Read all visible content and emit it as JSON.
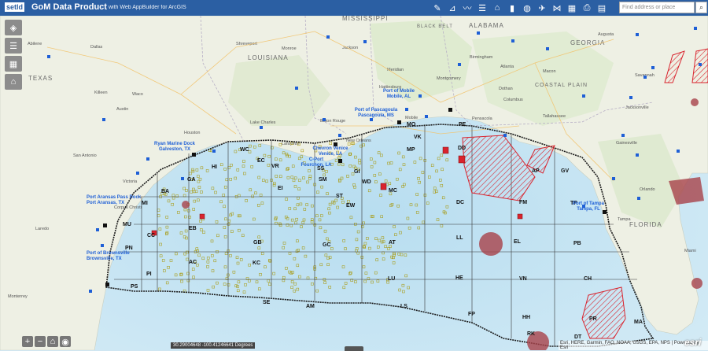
{
  "header": {
    "logo": "setld",
    "title": "GoM Data Product",
    "subtitle": "with Web AppBuilder for ArcGIS",
    "search_placeholder": "Find address or place",
    "tools": [
      "pen-icon",
      "ruler-icon",
      "chart-icon",
      "layers-list-icon",
      "graduation-icon",
      "bar-chart-icon",
      "globe-icon",
      "bird-icon",
      "fish-icon",
      "grid-icon",
      "print-icon",
      "table-icon"
    ]
  },
  "side_widgets": [
    "layers-icon",
    "legend-icon",
    "basemap-icon",
    "bookmark-icon"
  ],
  "states": [
    {
      "name": "MISSISSIPPI"
    },
    {
      "name": "ALABAMA"
    },
    {
      "name": "GEORGIA"
    },
    {
      "name": "LOUISIANA"
    },
    {
      "name": "TEXAS"
    },
    {
      "name": "FLORIDA"
    },
    {
      "name": "BLACK BELT"
    },
    {
      "name": "COASTAL PLAIN"
    }
  ],
  "cities": [
    {
      "name": "Abilene"
    },
    {
      "name": "Dallas"
    },
    {
      "name": "Shreveport"
    },
    {
      "name": "Monroe"
    },
    {
      "name": "Jackson"
    },
    {
      "name": "Meridian"
    },
    {
      "name": "Birmingham"
    },
    {
      "name": "Atlanta"
    },
    {
      "name": "Montgomery"
    },
    {
      "name": "Columbus"
    },
    {
      "name": "Macon"
    },
    {
      "name": "Augusta"
    },
    {
      "name": "Savannah"
    },
    {
      "name": "Tallahassee"
    },
    {
      "name": "Jacksonville"
    },
    {
      "name": "Gainesville"
    },
    {
      "name": "Orlando"
    },
    {
      "name": "Tampa"
    },
    {
      "name": "Miami"
    },
    {
      "name": "Houston"
    },
    {
      "name": "Austin"
    },
    {
      "name": "San Antonio"
    },
    {
      "name": "Corpus Christi"
    },
    {
      "name": "Laredo"
    },
    {
      "name": "Monterrey"
    },
    {
      "name": "Baton Rouge"
    },
    {
      "name": "New Orleans"
    },
    {
      "name": "Lafayette"
    },
    {
      "name": "Lake Charles"
    },
    {
      "name": "Mobile"
    },
    {
      "name": "Pensacola"
    },
    {
      "name": "Hattiesburg"
    },
    {
      "name": "Dothan"
    },
    {
      "name": "Waco"
    },
    {
      "name": "Killeen"
    },
    {
      "name": "Victoria"
    }
  ],
  "ports": [
    {
      "name": "Port of Mobile - Mobile, AL"
    },
    {
      "name": "Port of Pascagoula - Pascagoula, MS"
    },
    {
      "name": "Chevron Venice - Venice, LA"
    },
    {
      "name": "C-Port - Fourchon, LA"
    },
    {
      "name": "Ryan Marine Dock - Galveston, TX"
    },
    {
      "name": "Port Aransas Pass Dock - Port Aransas, TX"
    },
    {
      "name": "Port of Brownsville - Brownsville, TX"
    },
    {
      "name": "Port of Tampa - Tampa, FL"
    }
  ],
  "areas": [
    "MO",
    "VK",
    "PE",
    "DD",
    "MP",
    "WC",
    "HI",
    "EC",
    "VR",
    "SM",
    "SS",
    "WD",
    "GI",
    "ST",
    "EW",
    "MC",
    "DC",
    "AP",
    "GV",
    "FM",
    "TP",
    "GA",
    "BA",
    "MI",
    "MU",
    "PN",
    "PI",
    "PS",
    "CC",
    "EB",
    "GB",
    "AC",
    "KC",
    "GC",
    "AT",
    "LL",
    "EL",
    "PB",
    "LU",
    "HE",
    "VN",
    "CH",
    "SE",
    "AM",
    "LS",
    "FP",
    "HH",
    "PR",
    "MA",
    "RK",
    "DT",
    "EI"
  ],
  "coordinates": "30.29004648 -100.41246641 Degrees",
  "attribution": "Esri, HERE, Garmin, FAO, NOAA, USGS, EPA, NPS | Powered by Esri",
  "esri": "esri",
  "zoom": [
    "+",
    "−"
  ],
  "colors": {
    "header": "#2b5fa3",
    "protraction": "#222222",
    "lease": "#c8b400",
    "closure": "#d9232d",
    "circle": "#a8424a",
    "ports": "#1e5fd6"
  }
}
